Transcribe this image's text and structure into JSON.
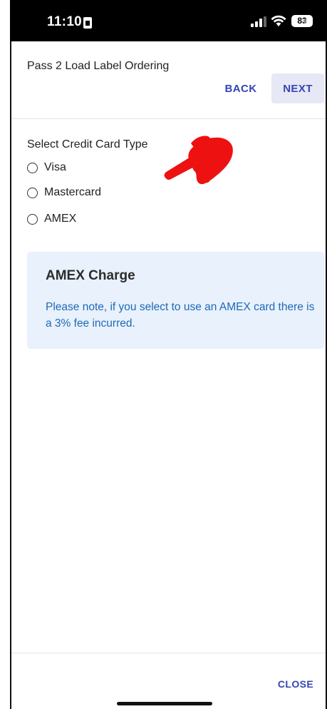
{
  "status_bar": {
    "time": "11:10",
    "battery": "83",
    "icons": [
      "sim-card-icon",
      "cellular-signal-icon",
      "wifi-icon",
      "battery-icon"
    ]
  },
  "header": {
    "title": "Pass 2 Load Label Ordering",
    "back_label": "BACK",
    "next_label": "NEXT"
  },
  "form": {
    "label": "Select Credit Card Type",
    "options": [
      {
        "label": "Visa",
        "selected": false
      },
      {
        "label": "Mastercard",
        "selected": false
      },
      {
        "label": "AMEX",
        "selected": false
      }
    ]
  },
  "notice": {
    "title": "AMEX Charge",
    "text": "Please note, if you select to use an AMEX card there is a 3% fee incurred."
  },
  "footer": {
    "close_label": "CLOSE"
  },
  "annotation": {
    "icon": "pointing-hand-icon",
    "color": "#ee1111"
  },
  "colors": {
    "accent": "#3446b4",
    "notice_bg": "#e8f1fc",
    "notice_text": "#1f69b6",
    "next_bg": "#e7e8f5"
  }
}
